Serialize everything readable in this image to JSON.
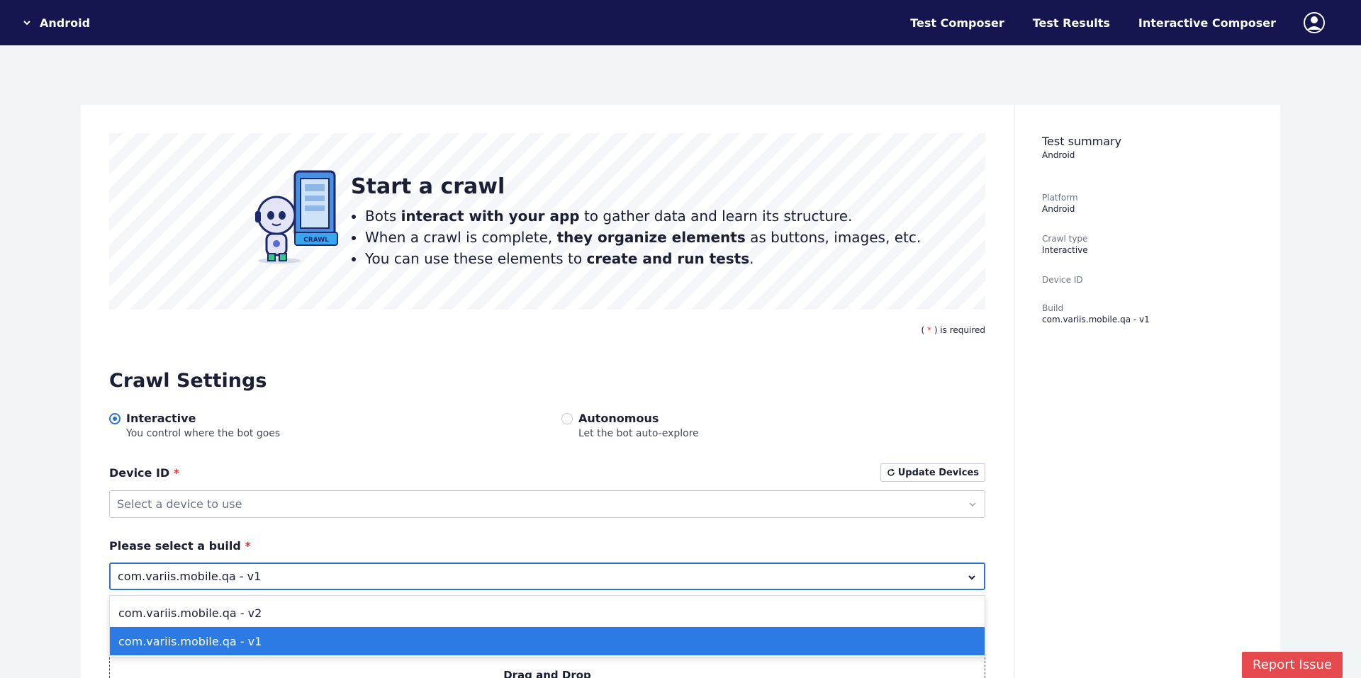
{
  "topbar": {
    "platform_label": "Android",
    "nav": [
      "Test Composer",
      "Test Results",
      "Interactive Composer"
    ]
  },
  "banner": {
    "title": "Start a crawl",
    "robot_screen_label": "CRAWL",
    "bullets": [
      {
        "pre": "Bots ",
        "bold": "interact with your app",
        "post": " to gather data and learn its structure."
      },
      {
        "pre": "When a crawl is complete, ",
        "bold": "they organize elements",
        "post": " as buttons, images, etc."
      },
      {
        "pre": "You can use these elements to ",
        "bold": "create and run tests",
        "post": "."
      }
    ]
  },
  "required_note": {
    "open": "( ",
    "star": "*",
    "close": " ) is required"
  },
  "crawl_settings": {
    "title": "Crawl Settings",
    "modes": [
      {
        "label": "Interactive",
        "sub": "You control where the bot goes",
        "selected": true
      },
      {
        "label": "Autonomous",
        "sub": "Let the bot auto-explore",
        "selected": false
      }
    ],
    "device": {
      "label": "Device ID",
      "star": "*",
      "update_button": "Update Devices",
      "placeholder": "Select a device to use"
    },
    "build": {
      "label": "Please select a build",
      "star": "*",
      "value": "com.variis.mobile.qa - v1",
      "options": [
        "com.variis.mobile.qa - v2",
        "com.variis.mobile.qa - v1"
      ],
      "selected_index": 1
    },
    "dropzone_label": "Drag and Drop"
  },
  "summary": {
    "title": "Test summary",
    "subtitle": "Android",
    "fields": [
      {
        "key": "Platform",
        "value": "Android"
      },
      {
        "key": "Crawl type",
        "value": "Interactive"
      },
      {
        "key": "Device ID",
        "value": ""
      },
      {
        "key": "Build",
        "value": "com.variis.mobile.qa - v1"
      }
    ]
  },
  "report_button": "Report Issue",
  "colors": {
    "topbar": "#15154f",
    "accent": "#2d73d3",
    "selected_option": "#2c7be5",
    "required_star": "#e0333a",
    "report_button": "#e5484d"
  }
}
